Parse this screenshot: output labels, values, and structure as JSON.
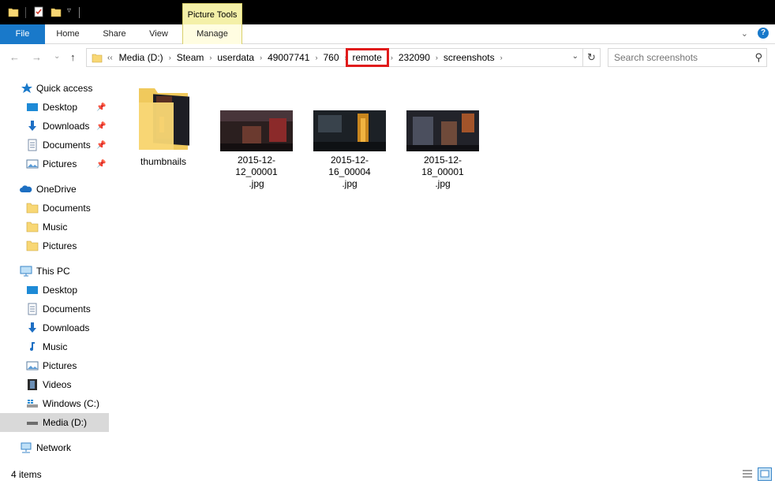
{
  "ribbon": {
    "contextual_group": "Picture Tools",
    "tabs": {
      "file": "File",
      "home": "Home",
      "share": "Share",
      "view": "View",
      "manage": "Manage"
    },
    "help": "?"
  },
  "navigation": {
    "back": "←",
    "forward": "→",
    "recent": "⌄",
    "up": "↑"
  },
  "address_bar": {
    "overflow": "‹‹",
    "crumbs": [
      "Media (D:)",
      "Steam",
      "userdata",
      "49007741",
      "760",
      "remote",
      "232090",
      "screenshots"
    ],
    "separator": "›",
    "highlighted": "remote"
  },
  "search": {
    "placeholder": "Search screenshots"
  },
  "sidebar": {
    "quick_access": "Quick access",
    "quick_items": [
      "Desktop",
      "Downloads",
      "Documents",
      "Pictures"
    ],
    "onedrive": "OneDrive",
    "onedrive_items": [
      "Documents",
      "Music",
      "Pictures"
    ],
    "this_pc": "This PC",
    "pc_items": [
      "Desktop",
      "Documents",
      "Downloads",
      "Music",
      "Pictures",
      "Videos",
      "Windows (C:)",
      "Media (D:)"
    ],
    "network": "Network",
    "selected": "Media (D:)"
  },
  "files": [
    {
      "name_line1": "thumbnails",
      "name_line2": "",
      "type": "folder"
    },
    {
      "name_line1": "2015-12-12_00001",
      "name_line2": ".jpg",
      "type": "image"
    },
    {
      "name_line1": "2015-12-16_00004",
      "name_line2": ".jpg",
      "type": "image"
    },
    {
      "name_line1": "2015-12-18_00001",
      "name_line2": ".jpg",
      "type": "image"
    }
  ],
  "status": {
    "items": "4 items"
  },
  "colors": {
    "accent": "#1979ca",
    "contextual": "#f4f0a8",
    "highlight": "#e01b1b",
    "folder": "#f8d775"
  }
}
